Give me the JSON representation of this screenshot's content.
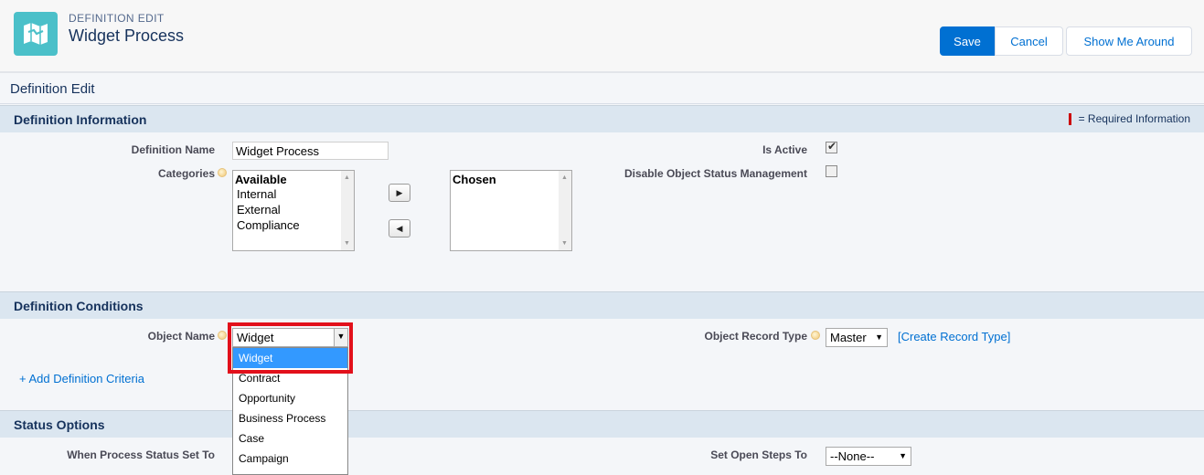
{
  "header": {
    "eyebrow": "DEFINITION EDIT",
    "title": "Widget Process",
    "icon": "map-icon",
    "buttons": {
      "save": "Save",
      "cancel": "Cancel",
      "tour": "Show Me Around"
    }
  },
  "subtitle": "Definition Edit",
  "sections": {
    "info": {
      "title": "Definition Information",
      "required_legend": "= Required Information",
      "definition_name_label": "Definition Name",
      "definition_name_value": "Widget Process",
      "categories_label": "Categories",
      "available": {
        "header": "Available",
        "items": [
          "Internal",
          "External",
          "Compliance"
        ]
      },
      "chosen": {
        "header": "Chosen",
        "items": []
      },
      "is_active_label": "Is Active",
      "is_active_checked": true,
      "disable_status_label": "Disable Object Status Management",
      "disable_status_checked": false
    },
    "conditions": {
      "title": "Definition Conditions",
      "object_name_label": "Object Name",
      "object_name_value": "Widget",
      "object_options": [
        "Widget",
        "Contract",
        "Opportunity",
        "Business Process",
        "Case",
        "Campaign"
      ],
      "object_record_type_label": "Object Record Type",
      "object_record_type_value": "Master",
      "create_record_type_link": "[Create Record Type]",
      "add_criteria_link": "+ Add Definition Criteria"
    },
    "status": {
      "title": "Status Options",
      "when_process_label": "When Process Status Set To",
      "set_open_steps_label": "Set Open Steps To",
      "set_open_steps_value": "--None--"
    }
  },
  "colors": {
    "accent": "#0070d2",
    "icon_bg": "#4bc0c9",
    "highlight": "#e2101b",
    "section_bg": "#dbe6f0"
  }
}
